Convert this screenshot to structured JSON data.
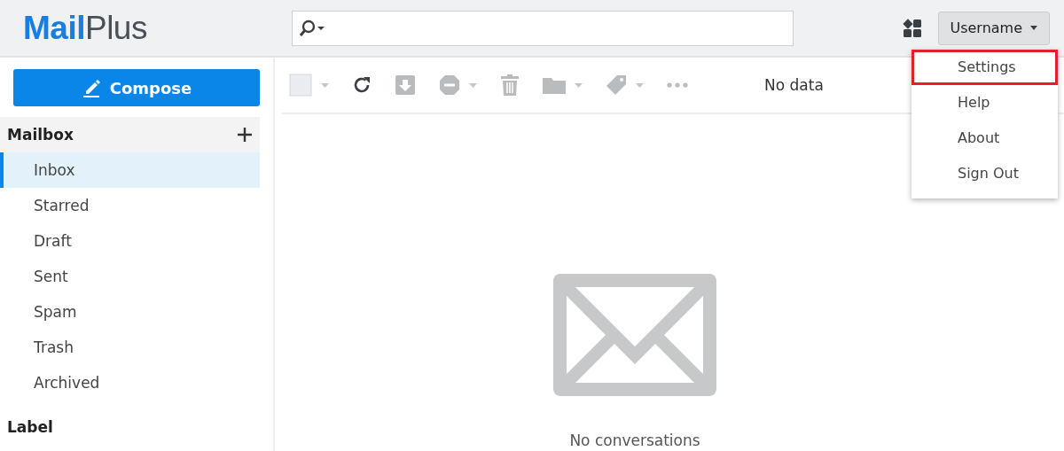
{
  "logo": {
    "brand": "Mail",
    "suffix": "Plus"
  },
  "user_button": {
    "label": "Username"
  },
  "user_menu": {
    "open": true,
    "items": [
      {
        "label": "Settings",
        "highlighted": true
      },
      {
        "label": "Help",
        "highlighted": false
      },
      {
        "label": "About",
        "highlighted": false
      },
      {
        "label": "Sign Out",
        "highlighted": false
      }
    ]
  },
  "compose_button": {
    "label": "Compose"
  },
  "sidebar": {
    "sections": [
      {
        "title": "Mailbox",
        "add_button": true,
        "items": [
          {
            "label": "Inbox",
            "selected": true
          },
          {
            "label": "Starred",
            "selected": false
          },
          {
            "label": "Draft",
            "selected": false
          },
          {
            "label": "Sent",
            "selected": false
          },
          {
            "label": "Spam",
            "selected": false
          },
          {
            "label": "Trash",
            "selected": false
          },
          {
            "label": "Archived",
            "selected": false
          }
        ]
      },
      {
        "title": "Label",
        "add_button": false
      }
    ]
  },
  "toolbar": {
    "tools": [
      {
        "kind": "select",
        "disabled": true,
        "dropdown": true
      },
      {
        "kind": "refresh",
        "disabled": false,
        "dropdown": false
      },
      {
        "kind": "archive",
        "disabled": true,
        "dropdown": false
      },
      {
        "kind": "spam",
        "disabled": true,
        "dropdown": true
      },
      {
        "kind": "delete",
        "disabled": true,
        "dropdown": false
      },
      {
        "kind": "move",
        "disabled": true,
        "dropdown": true
      },
      {
        "kind": "label",
        "disabled": true,
        "dropdown": true
      },
      {
        "kind": "more",
        "disabled": true,
        "dropdown": false
      }
    ],
    "status": "No data"
  },
  "empty_state": {
    "message": "No conversations"
  }
}
